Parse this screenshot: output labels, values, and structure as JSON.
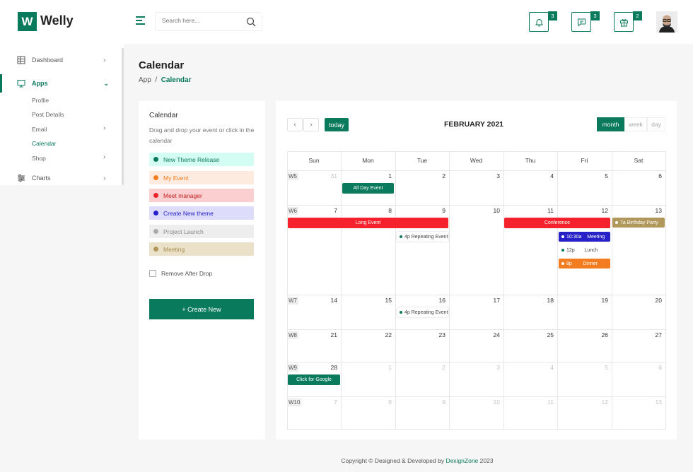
{
  "brand": {
    "logo_letter": "W",
    "name": "Welly"
  },
  "sidebar": {
    "items": [
      {
        "label": "Dashboard",
        "icon": "dashboard-icon"
      },
      {
        "label": "Apps",
        "icon": "monitor-icon"
      },
      {
        "label": "Charts",
        "icon": "sliders-icon"
      }
    ],
    "subitems": [
      {
        "label": "Profile"
      },
      {
        "label": "Post Details"
      },
      {
        "label": "Email"
      },
      {
        "label": "Calendar"
      },
      {
        "label": "Shop"
      }
    ]
  },
  "header": {
    "search_placeholder": "Search here...",
    "notifications_count": "3",
    "messages_count": "3",
    "gifts_count": "2"
  },
  "page": {
    "title": "Calendar",
    "crumb_root": "App",
    "crumb_sep": "/",
    "crumb_current": "Calendar"
  },
  "events_panel": {
    "title": "Calendar",
    "description": "Drag and drop your event or click in the calendar",
    "events": [
      {
        "label": "New Theme Release",
        "bg": "#d3fcf3",
        "color": "#0a7a5c",
        "dot": "#0a7a5c"
      },
      {
        "label": "My Event",
        "bg": "#fdebdf",
        "color": "#f47c20",
        "dot": "#f47c20"
      },
      {
        "label": "Meet manager",
        "bg": "#fbcfcf",
        "color": "#c01f24",
        "dot": "#e8242a"
      },
      {
        "label": "Create New theme",
        "bg": "#dddcfb",
        "color": "#2622c8",
        "dot": "#2622c8"
      },
      {
        "label": "Project Launch",
        "bg": "#eeeeee",
        "color": "#888888",
        "dot": "#aaaaaa"
      },
      {
        "label": "Meeting",
        "bg": "#ebe1c9",
        "color": "#a88c4c",
        "dot": "#b0975a"
      }
    ],
    "remove_after_drop": "Remove After Drop",
    "create_button": "+  Create New"
  },
  "calendar": {
    "today_label": "today",
    "title": "FEBRUARY 2021",
    "views": [
      "month",
      "week",
      "day"
    ],
    "weekdays": [
      "Sun",
      "Mon",
      "Tue",
      "Wed",
      "Thu",
      "Fri",
      "Sat"
    ],
    "weeks": [
      {
        "label": "W5",
        "days": [
          "31",
          "1",
          "2",
          "3",
          "4",
          "5",
          "6"
        ]
      },
      {
        "label": "W6",
        "days": [
          "7",
          "8",
          "9",
          "10",
          "11",
          "12",
          "13"
        ]
      },
      {
        "label": "W7",
        "days": [
          "14",
          "15",
          "16",
          "17",
          "18",
          "19",
          "20"
        ]
      },
      {
        "label": "W8",
        "days": [
          "21",
          "22",
          "23",
          "24",
          "25",
          "26",
          "27"
        ]
      },
      {
        "label": "W9",
        "days": [
          "28",
          "1",
          "2",
          "3",
          "4",
          "5",
          "6"
        ]
      },
      {
        "label": "W10",
        "days": [
          "7",
          "8",
          "9",
          "10",
          "11",
          "12",
          "13"
        ]
      }
    ],
    "events": {
      "all_day": "All Day Event",
      "long_event": "Long Event",
      "conference": "Conference",
      "birthday_time": "7a",
      "birthday": "Birthday Party",
      "repeating_1": "4p Repeating Event",
      "meeting_time": "10:30a",
      "meeting": "Meeting",
      "lunch_time": "12p",
      "lunch": "Lunch",
      "dinner_time": "8p",
      "dinner": "Dinner",
      "repeating_2": "4p Repeating Event",
      "google": "Click for Google"
    }
  },
  "footer": {
    "text": "Copyright © Designed & Developed by ",
    "brand": "DexignZone",
    "year": " 2023"
  },
  "colors": {
    "accent": "#0a7a5c",
    "red": "#f5222d",
    "blue": "#2622c8",
    "orange": "#f47c20",
    "gold": "#b0975a"
  }
}
